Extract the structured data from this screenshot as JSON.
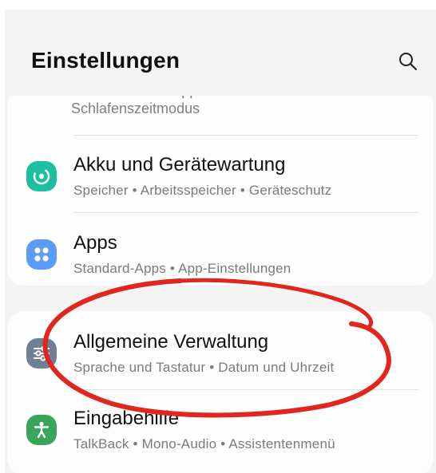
{
  "header": {
    "title": "Einstellungen",
    "search_icon": "search-icon"
  },
  "partial_item": {
    "title": "Bildschirmzeit • App-Timer",
    "subtitle": "Schlafenszeitmodus"
  },
  "items": [
    {
      "title": "Akku und Gerätewartung",
      "subtitle": "Speicher • Arbeitsspeicher • Geräteschutz",
      "icon": "device-care-icon",
      "color": "#1dbfa0"
    },
    {
      "title": "Apps",
      "subtitle": "Standard-Apps • App-Einstellungen",
      "icon": "apps-icon",
      "color": "#5a9cf5"
    },
    {
      "title": "Allgemeine Verwaltung",
      "subtitle": "Sprache und Tastatur • Datum und Uhrzeit",
      "icon": "sliders-icon",
      "color": "#6f8295"
    },
    {
      "title": "Eingabehilfe",
      "subtitle": "TalkBack • Mono-Audio • Assistentenmenü",
      "icon": "accessibility-icon",
      "color": "#3aa55a"
    }
  ],
  "annotation": {
    "type": "hand-drawn-circle",
    "color": "#e0261d",
    "target": "Allgemeine Verwaltung"
  }
}
